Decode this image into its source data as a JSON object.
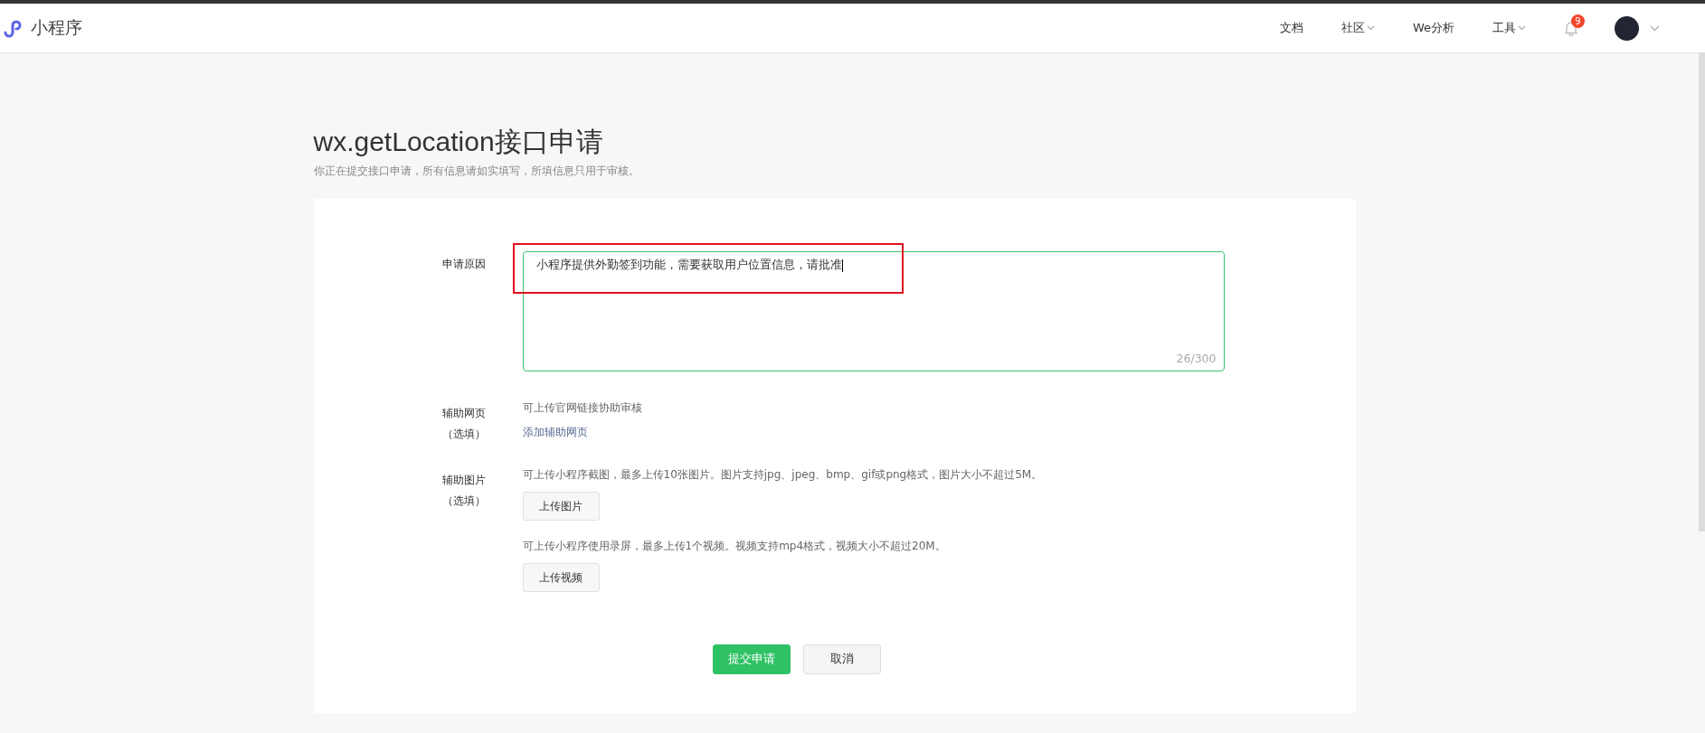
{
  "header": {
    "logo_text": "小程序",
    "nav": [
      {
        "label": "文档",
        "dropdown": false
      },
      {
        "label": "社区",
        "dropdown": true
      },
      {
        "label": "We分析",
        "dropdown": false
      },
      {
        "label": "工具",
        "dropdown": true
      }
    ],
    "notification_count": "9"
  },
  "page": {
    "title": "wx.getLocation接口申请",
    "subtitle": "你正在提交接口申请，所有信息请如实填写，所填信息只用于审核。"
  },
  "form": {
    "reason": {
      "label": "申请原因",
      "value": "小程序提供外勤签到功能，需要获取用户位置信息，请批准",
      "counter": "26/300"
    },
    "webpage": {
      "label_lines": [
        "辅助网页",
        "（选填）"
      ],
      "hint": "可上传官网链接协助审核",
      "link": "添加辅助网页"
    },
    "images": {
      "label_lines": [
        "辅助图片",
        "（选填）"
      ],
      "uploads": [
        {
          "hint": "可上传小程序截图，最多上传10张图片。图片支持jpg、jpeg、bmp、gif或png格式，图片大小不超过5M。",
          "button": "上传图片"
        },
        {
          "hint": "可上传小程序使用录屏，最多上传1个视频。视频支持mp4格式，视频大小不超过20M。",
          "button": "上传视频"
        }
      ]
    }
  },
  "actions": [
    {
      "label": "提交申请",
      "kind": "primary"
    },
    {
      "label": "取消",
      "kind": "default"
    }
  ]
}
